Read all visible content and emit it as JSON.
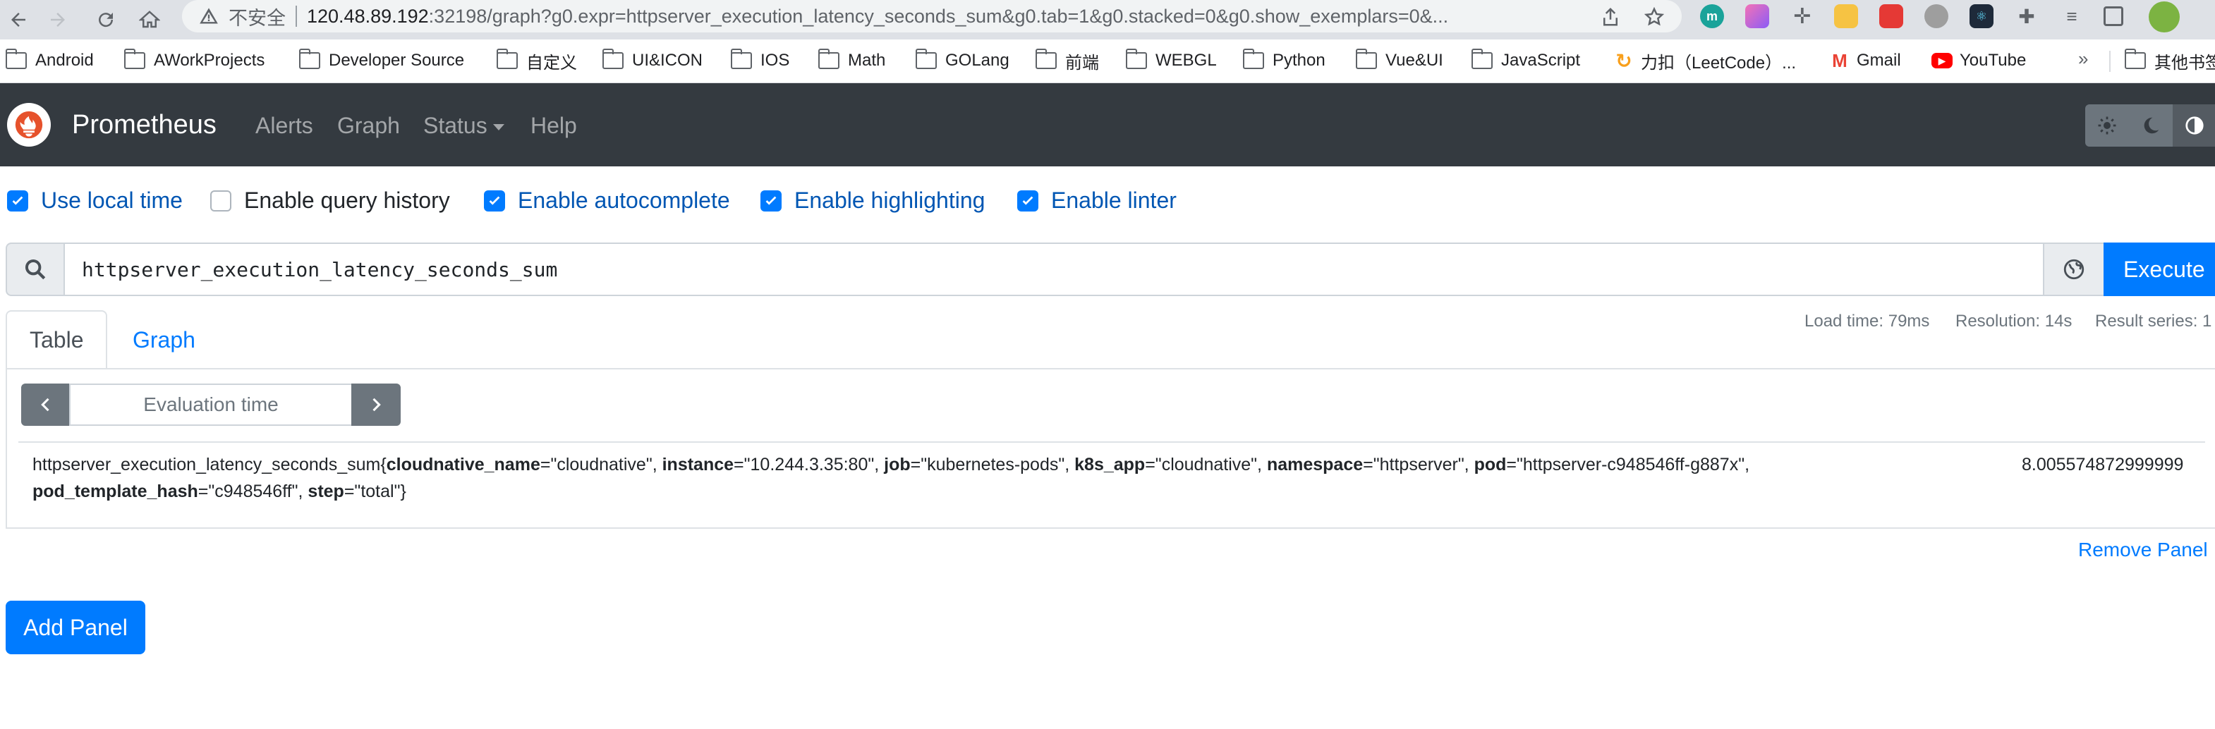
{
  "browser": {
    "security_label": "不安全",
    "url_host": "120.48.89.192",
    "url_rest": ":32198/graph?g0.expr=httpserver_execution_latency_seconds_sum&g0.tab=1&g0.stacked=0&g0.show_exemplars=0&...",
    "extensions": [
      {
        "name": "m-extension-icon",
        "color": "#1aa39a",
        "label": "m"
      },
      {
        "name": "gradient-extension-icon",
        "color": "#a855f7",
        "label": ""
      },
      {
        "name": "move-extension-icon",
        "color": "#ffffff",
        "label": ""
      },
      {
        "name": "note-extension-icon",
        "color": "#f6c343",
        "label": ""
      },
      {
        "name": "dice-extension-icon",
        "color": "#e53935",
        "label": ""
      },
      {
        "name": "avatar-extension-icon",
        "color": "#9e9e9e",
        "label": ""
      },
      {
        "name": "react-extension-icon",
        "color": "#1e2a3a",
        "label": ""
      }
    ],
    "bookmarks": [
      "Android",
      "AWorkProjects",
      "Developer Source",
      "自定义",
      "UI&ICON",
      "IOS",
      "Math",
      "GOLang",
      "前端",
      "WEBGL",
      "Python",
      "Vue&UI",
      "JavaScript",
      "力扣（LeetCode）...",
      "Gmail",
      "YouTube"
    ],
    "bookmarks_more": "»",
    "other_bookmarks": "其他书签"
  },
  "navbar": {
    "brand": "Prometheus",
    "links": [
      "Alerts",
      "Graph",
      "Status",
      "Help"
    ]
  },
  "options": [
    {
      "label": "Use local time",
      "checked": true
    },
    {
      "label": "Enable query history",
      "checked": false
    },
    {
      "label": "Enable autocomplete",
      "checked": true
    },
    {
      "label": "Enable highlighting",
      "checked": true
    },
    {
      "label": "Enable linter",
      "checked": true
    }
  ],
  "query": {
    "expression": "httpserver_execution_latency_seconds_sum",
    "execute_label": "Execute"
  },
  "tabs": {
    "table": "Table",
    "graph": "Graph",
    "active": "Table"
  },
  "stats": {
    "load_time": "Load time: 79ms",
    "resolution": "Resolution: 14s",
    "result_series": "Result series: 1"
  },
  "eval": {
    "placeholder": "Evaluation time"
  },
  "result": {
    "metric": "httpserver_execution_latency_seconds_sum",
    "labels": [
      {
        "key": "cloudnative_name",
        "value": "cloudnative"
      },
      {
        "key": "instance",
        "value": "10.244.3.35:80"
      },
      {
        "key": "job",
        "value": "kubernetes-pods"
      },
      {
        "key": "k8s_app",
        "value": "cloudnative"
      },
      {
        "key": "namespace",
        "value": "httpserver"
      },
      {
        "key": "pod",
        "value": "httpserver-c948546ff-g887x"
      },
      {
        "key": "pod_template_hash",
        "value": "c948546ff"
      },
      {
        "key": "step",
        "value": "total"
      }
    ],
    "value": "8.005574872999999"
  },
  "actions": {
    "remove_panel": "Remove Panel",
    "add_panel": "Add Panel"
  },
  "colors": {
    "navbar": "#343a40",
    "primary": "#007bff",
    "secondary": "#6c757d"
  }
}
